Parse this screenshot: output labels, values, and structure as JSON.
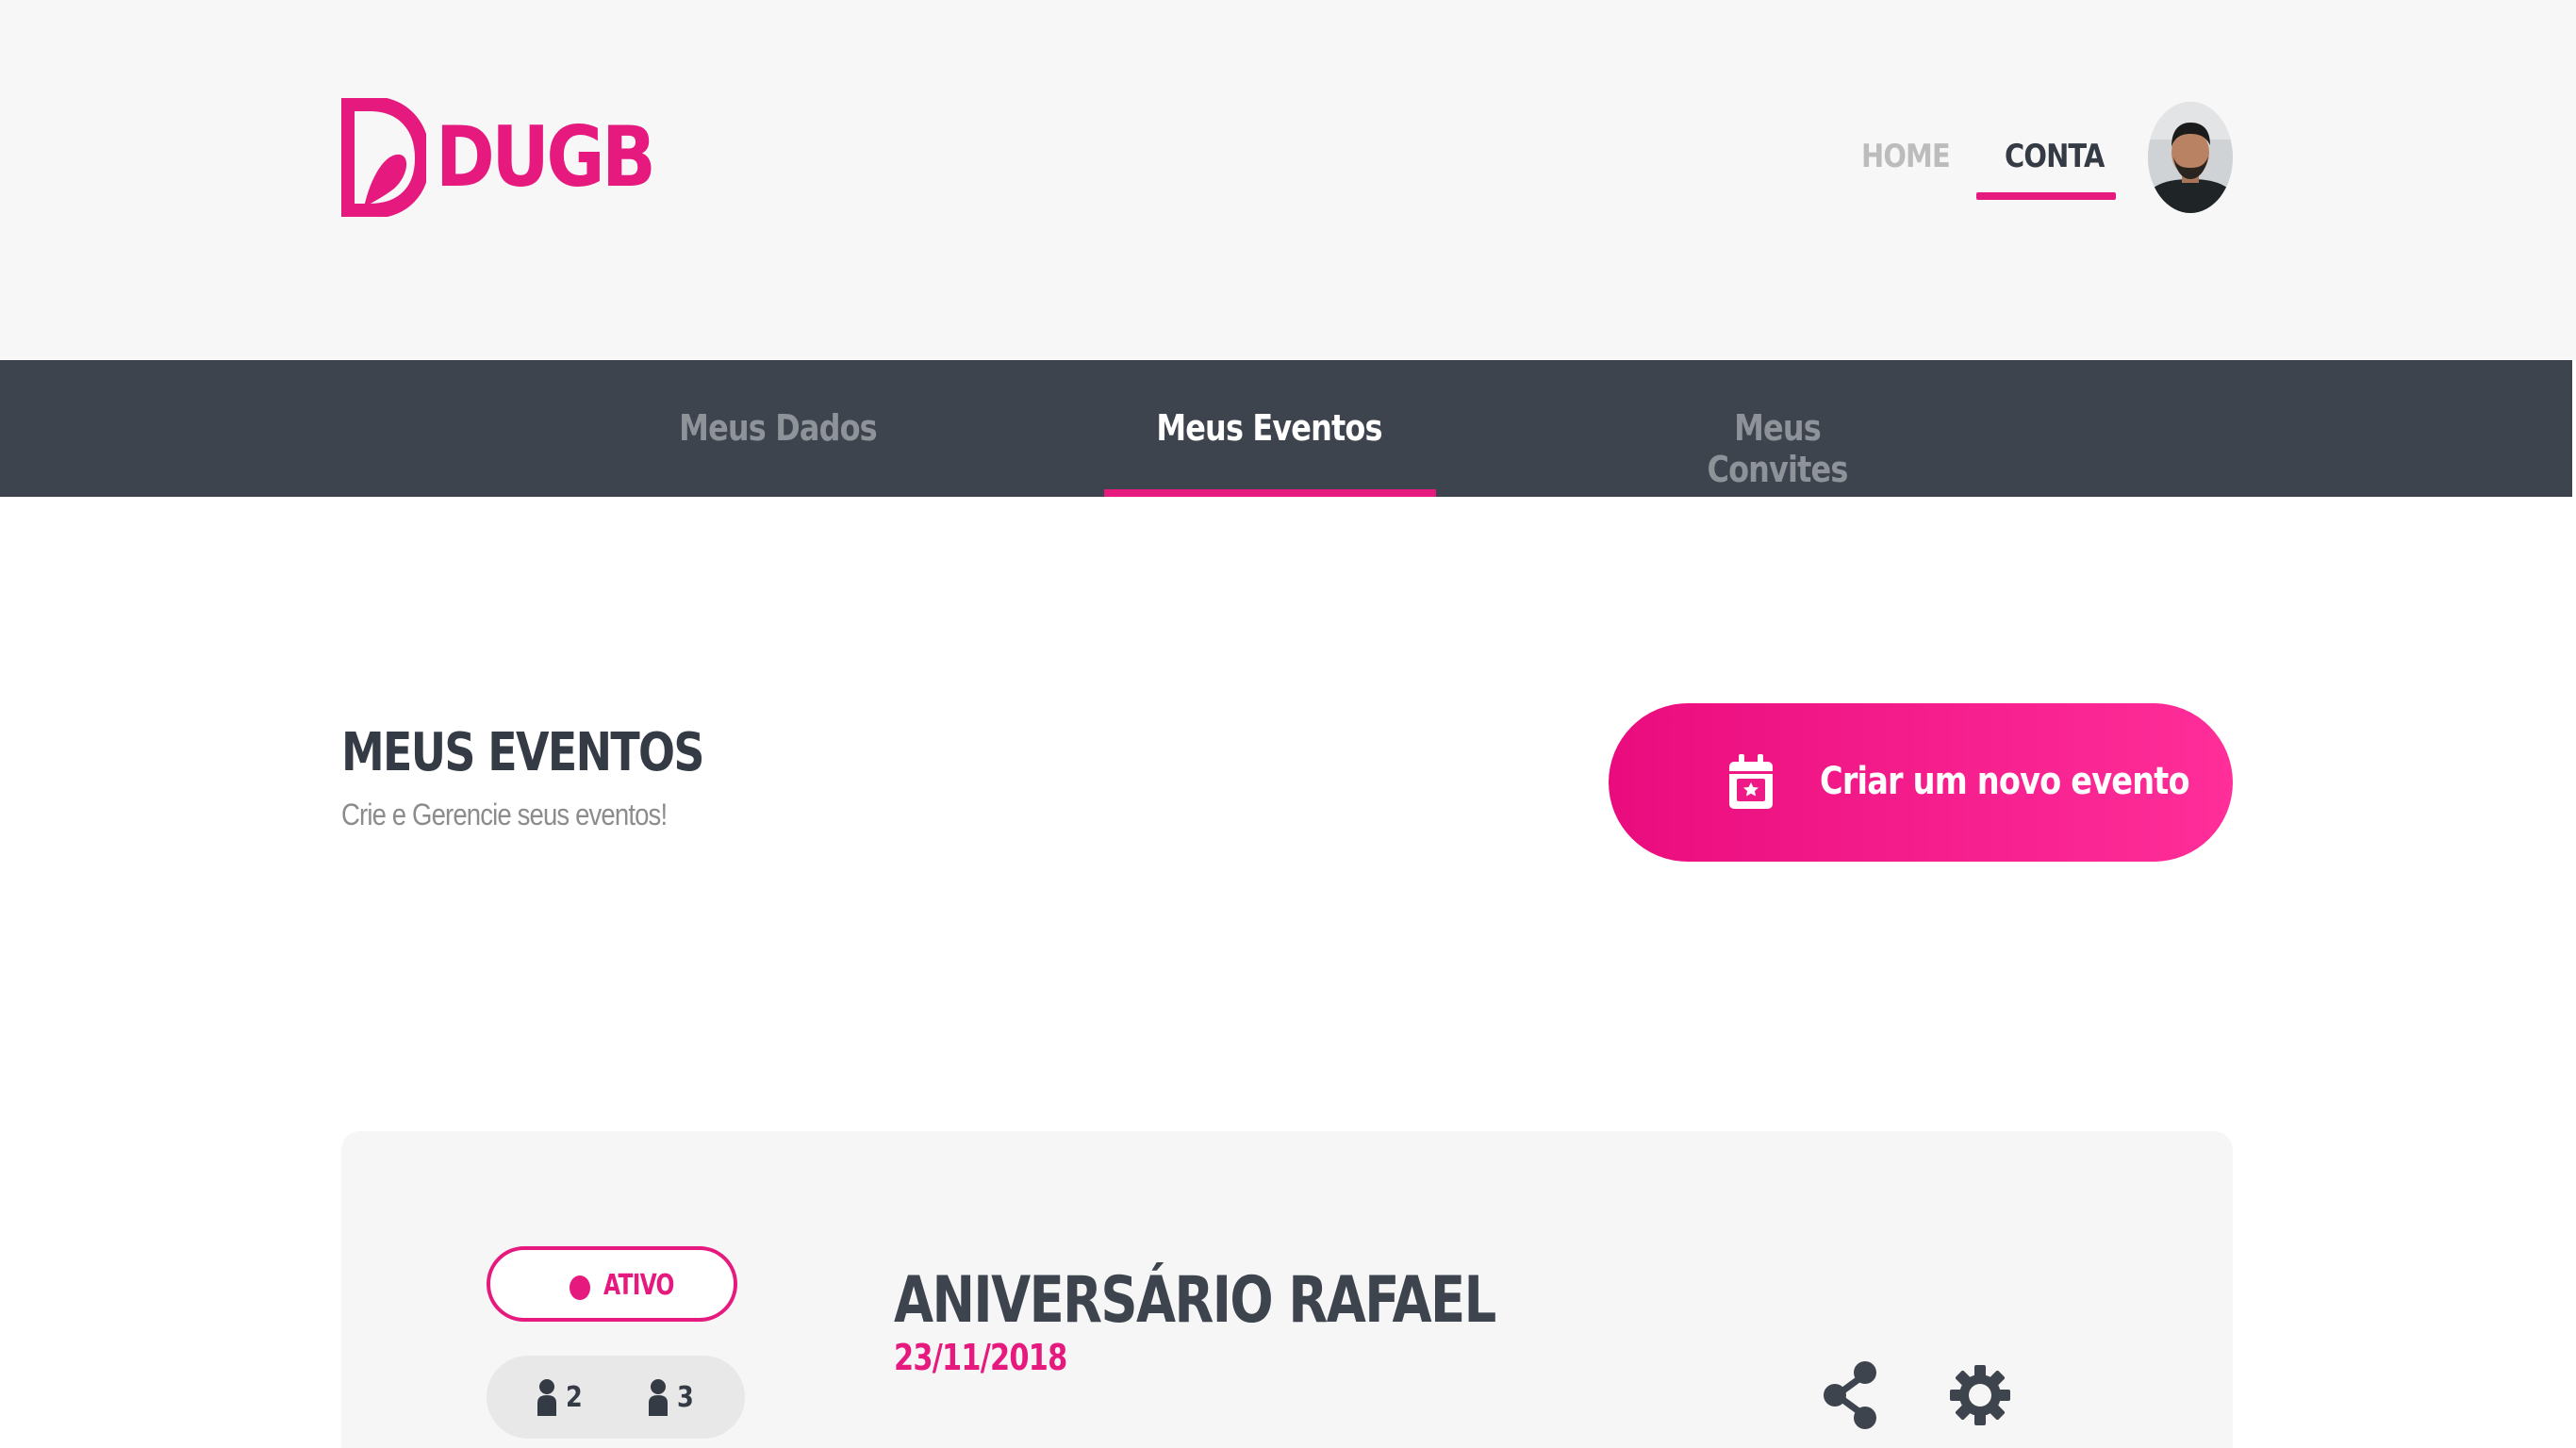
{
  "brand": {
    "name": "DUGB",
    "color": "#e6197e",
    "icon": "dugb-logo-icon"
  },
  "top_nav": {
    "home_label": "HOME",
    "account_label": "CONTA",
    "active": "account"
  },
  "user": {
    "avatar_icon": "avatar-photo"
  },
  "sub_nav": {
    "tabs": [
      {
        "label": "Meus Dados",
        "active": false
      },
      {
        "label": "Meus Eventos",
        "active": true
      },
      {
        "label": "Meus Convites",
        "active": false
      }
    ]
  },
  "section": {
    "title": "MEUS EVENTOS",
    "subtitle": "Crie e Gerencie seus eventos!"
  },
  "create_button": {
    "label": "Criar um novo evento",
    "icon": "calendar-star-icon"
  },
  "events": [
    {
      "status": "ATIVO",
      "count_a": "2",
      "count_b": "3",
      "title": "ANIVERSÁRIO RAFAEL",
      "date": "23/11/2018",
      "actions": [
        "share-icon",
        "settings-icon"
      ]
    }
  ],
  "colors": {
    "accent": "#e6197e",
    "dark": "#3d444d",
    "header_bg": "#f7f7f7",
    "card_bg": "#f6f6f6"
  }
}
